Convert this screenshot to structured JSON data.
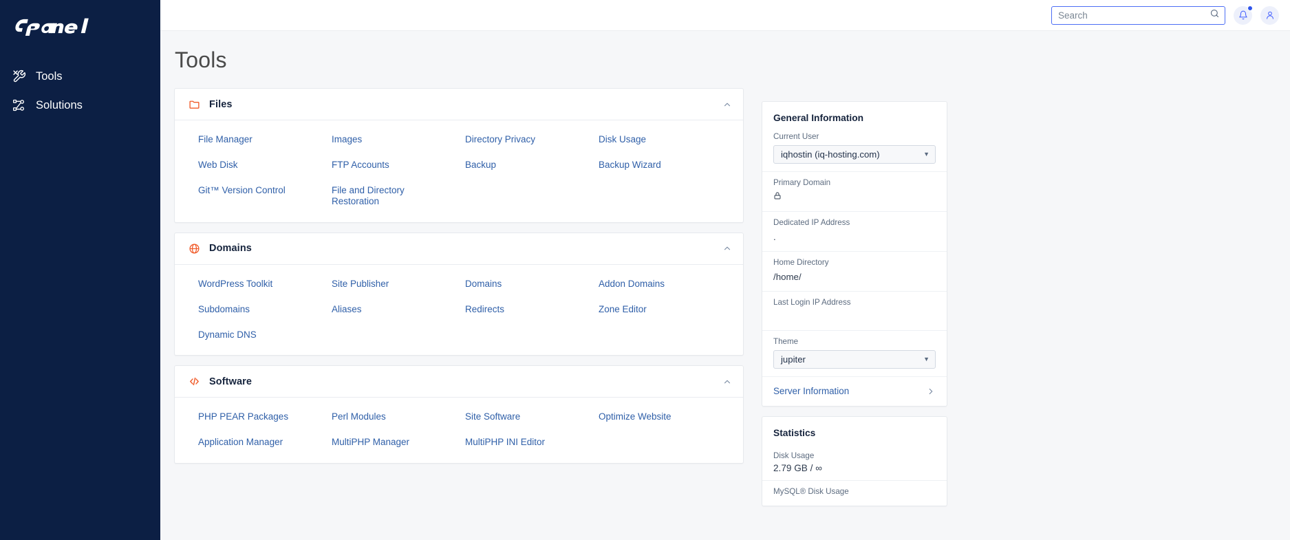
{
  "brand": {
    "logo_text": "cPanel",
    "accent_color": "#f05a28",
    "sidebar_color": "#0c1f44"
  },
  "sidebar": {
    "items": [
      {
        "label": "Tools",
        "icon": "tools-icon"
      },
      {
        "label": "Solutions",
        "icon": "solutions-icon"
      }
    ]
  },
  "header": {
    "search_placeholder": "Search",
    "search_value": "",
    "notifications_icon": "bell-icon",
    "has_notification_badge": true,
    "account_icon": "user-icon"
  },
  "page": {
    "title": "Tools"
  },
  "sections": [
    {
      "title": "Files",
      "icon": "folder-icon",
      "expanded": true,
      "links": [
        "File Manager",
        "Images",
        "Directory Privacy",
        "Disk Usage",
        "Web Disk",
        "FTP Accounts",
        "Backup",
        "Backup Wizard",
        "Git™ Version Control",
        "File and Directory Restoration"
      ]
    },
    {
      "title": "Domains",
      "icon": "globe-icon",
      "expanded": true,
      "links": [
        "WordPress Toolkit",
        "Site Publisher",
        "Domains",
        "Addon Domains",
        "Subdomains",
        "Aliases",
        "Redirects",
        "Zone Editor",
        "Dynamic DNS"
      ]
    },
    {
      "title": "Software",
      "icon": "code-icon",
      "expanded": true,
      "links": [
        "PHP PEAR Packages",
        "Perl Modules",
        "Site Software",
        "Optimize Website",
        "Application Manager",
        "MultiPHP Manager",
        "MultiPHP INI Editor"
      ]
    }
  ],
  "general_information": {
    "title": "General Information",
    "current_user": {
      "label": "Current User",
      "value": "iqhostin (iq-hosting.com)"
    },
    "primary_domain": {
      "label": "Primary Domain",
      "value": "",
      "icon": "lock-icon"
    },
    "dedicated_ip": {
      "label": "Dedicated IP Address",
      "value": "."
    },
    "home_directory": {
      "label": "Home Directory",
      "value": "/home/"
    },
    "last_login_ip": {
      "label": "Last Login IP Address",
      "value": ""
    },
    "theme": {
      "label": "Theme",
      "value": "jupiter"
    },
    "server_information": {
      "label": "Server Information",
      "icon": "chevron-right-icon"
    }
  },
  "statistics": {
    "title": "Statistics",
    "rows": [
      {
        "label": "Disk Usage",
        "value": "2.79 GB / ∞"
      },
      {
        "label": "MySQL® Disk Usage",
        "value": ""
      }
    ]
  }
}
